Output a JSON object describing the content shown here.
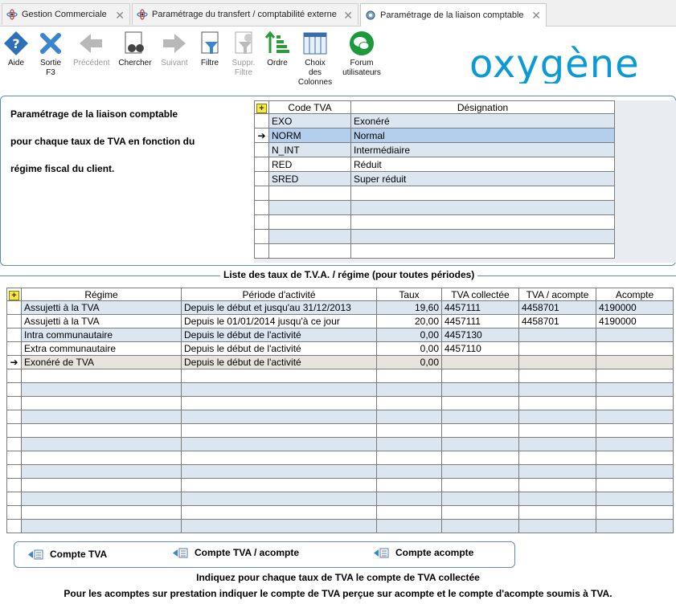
{
  "tabs": [
    {
      "label": "Gestion Commerciale"
    },
    {
      "label": "Paramétrage du transfert / comptabilité externe"
    },
    {
      "label": "Paramétrage de la liaison comptable"
    }
  ],
  "toolbar": {
    "aide": "Aide",
    "sortie1": "Sortie",
    "sortie2": "F3",
    "precedent": "Précédent",
    "chercher": "Chercher",
    "suivant": "Suivant",
    "filtre": "Filtre",
    "suppr1": "Suppr.",
    "suppr2": "Filtre",
    "ordre": "Ordre",
    "choix1": "Choix",
    "choix2": "des",
    "choix3": "Colonnes",
    "forum1": "Forum",
    "forum2": "utilisateurs"
  },
  "logo": "oxygène",
  "panel": {
    "line1": "Paramétrage de la liaison comptable",
    "line2": "pour chaque taux de TVA en fonction du",
    "line3": "régime fiscal du client."
  },
  "grid1": {
    "headers": [
      "Code TVA",
      "Désignation"
    ],
    "rows": [
      {
        "code": "EXO",
        "designation": "Exonéré"
      },
      {
        "code": "NORM",
        "designation": "Normal"
      },
      {
        "code": "N_INT",
        "designation": "Intermédiaire"
      },
      {
        "code": "RED",
        "designation": "Réduit"
      },
      {
        "code": "SRED",
        "designation": "Super réduit"
      }
    ]
  },
  "list_title": "Liste des taux de T.V.A. / régime (pour toutes périodes)",
  "grid2": {
    "headers": [
      "Régime",
      "Période d'activité",
      "Taux",
      "TVA collectée",
      "TVA / acompte",
      "Acompte"
    ],
    "rows": [
      {
        "regime": "Assujetti à la TVA",
        "periode": "Depuis le début et jusqu'au 31/12/2013",
        "taux": "19,60",
        "collectee": "4457111",
        "acompte_tva": "4458701",
        "acompte": "4190000"
      },
      {
        "regime": "Assujetti à la TVA",
        "periode": "Depuis le 01/01/2014 jusqu'à ce jour",
        "taux": "20,00",
        "collectee": "4457111",
        "acompte_tva": "4458701",
        "acompte": "4190000"
      },
      {
        "regime": "Intra communautaire",
        "periode": "Depuis le début de l'activité",
        "taux": "0,00",
        "collectee": "4457130",
        "acompte_tva": "",
        "acompte": ""
      },
      {
        "regime": "Extra communautaire",
        "periode": "Depuis le début de l'activité",
        "taux": "0,00",
        "collectee": "4457110",
        "acompte_tva": "",
        "acompte": ""
      },
      {
        "regime": "Exonéré de TVA",
        "periode": "Depuis le début de l'activité",
        "taux": "0,00",
        "collectee": "",
        "acompte_tva": "",
        "acompte": ""
      }
    ]
  },
  "buttons": {
    "compte_tva": "Compte TVA",
    "compte_tva_acompte": "Compte TVA / acompte",
    "compte_acompte": "Compte acompte"
  },
  "footer": {
    "line1": "Indiquez pour chaque taux de TVA le compte de TVA collectée",
    "line2": "Pour les acomptes sur prestation indiquer le compte de TVA perçue sur acompte et le compte d'acompte soumis à TVA."
  }
}
